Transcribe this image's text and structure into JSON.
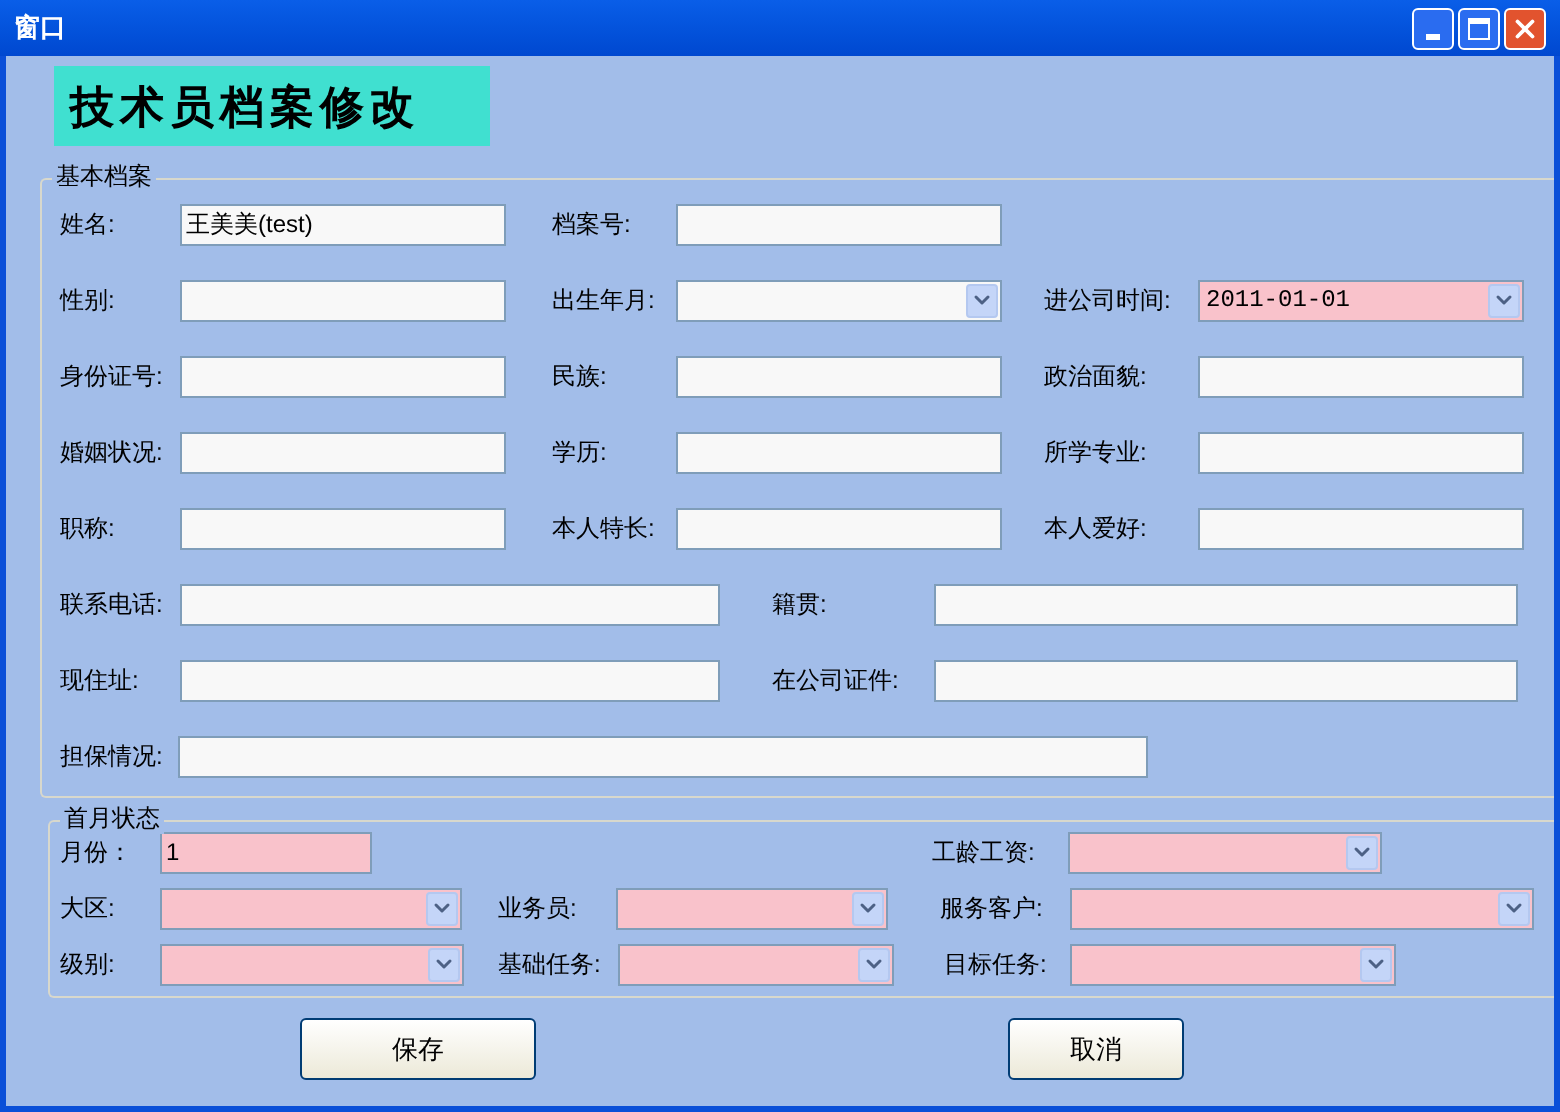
{
  "window": {
    "title": "窗口"
  },
  "heading": "技术员档案修改",
  "sections": [
    {
      "title": "基本档案",
      "rows": [
        [
          {
            "label": "姓名:",
            "kind": "text",
            "value": "王美美(test)",
            "highlighted": false
          },
          {
            "label": "档案号:",
            "kind": "text",
            "highlighted": false
          }
        ],
        [
          {
            "label": "性别:",
            "kind": "text",
            "highlighted": false
          },
          {
            "label": "出生年月:",
            "kind": "combo",
            "highlighted": false
          },
          {
            "label": "进公司时间:",
            "kind": "combo",
            "value": "2011-01-01",
            "highlighted": true
          }
        ],
        [
          {
            "label": "身份证号:",
            "kind": "text",
            "highlighted": false
          },
          {
            "label": "民族:",
            "kind": "text",
            "highlighted": false
          },
          {
            "label": "政治面貌:",
            "kind": "text",
            "highlighted": false
          }
        ],
        [
          {
            "label": "婚姻状况:",
            "kind": "text",
            "highlighted": false
          },
          {
            "label": "学历:",
            "kind": "text",
            "highlighted": false
          },
          {
            "label": "所学专业:",
            "kind": "text",
            "highlighted": false
          }
        ],
        [
          {
            "label": "职称:",
            "kind": "text",
            "highlighted": false
          },
          {
            "label": "本人特长:",
            "kind": "text",
            "highlighted": false
          },
          {
            "label": "本人爱好:",
            "kind": "text",
            "highlighted": false
          }
        ],
        [
          {
            "label": "联系电话:",
            "kind": "text",
            "highlighted": false
          },
          {
            "label": "籍贯:",
            "kind": "text",
            "highlighted": false
          }
        ],
        [
          {
            "label": "现住址:",
            "kind": "text",
            "highlighted": false
          },
          {
            "label": "在公司证件:",
            "kind": "text",
            "highlighted": false
          }
        ],
        [
          {
            "label": "担保情况:",
            "kind": "text",
            "highlighted": false
          }
        ]
      ]
    },
    {
      "title": "首月状态",
      "rows": [
        [
          {
            "label": "月份：",
            "kind": "text",
            "value": "1",
            "highlighted": true
          },
          {
            "kind": "empty"
          },
          {
            "label": "工龄工资:",
            "kind": "combo",
            "highlighted": true
          }
        ],
        [
          {
            "label": "大区:",
            "kind": "combo",
            "highlighted": true
          },
          {
            "label": "业务员:",
            "kind": "combo",
            "highlighted": true
          },
          {
            "label": "服务客户:",
            "kind": "combo",
            "highlighted": true
          }
        ],
        [
          {
            "label": "级别:",
            "kind": "combo",
            "highlighted": true
          },
          {
            "label": "基础任务:",
            "kind": "combo",
            "highlighted": true
          },
          {
            "label": "目标任务:",
            "kind": "combo",
            "highlighted": true
          }
        ]
      ]
    }
  ],
  "buttons": [
    "保存",
    "取消"
  ]
}
